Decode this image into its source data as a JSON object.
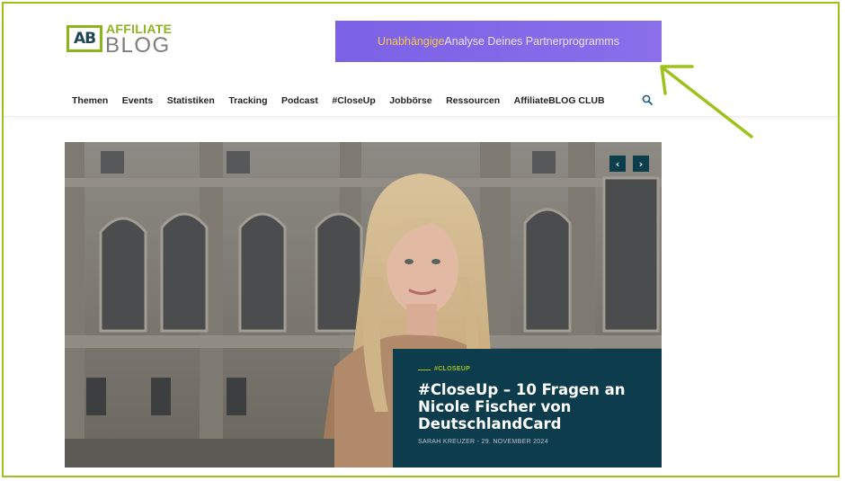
{
  "logo": {
    "mark": "AB",
    "top": "AFFILIATE",
    "bottom": "BLOG"
  },
  "banner": {
    "highlight": "Unabhängige",
    "text": " Analyse Deines Partnerprogramms"
  },
  "nav": {
    "items": [
      "Themen",
      "Events",
      "Statistiken",
      "Tracking",
      "Podcast",
      "#CloseUp",
      "Jobbörse",
      "Ressourcen",
      "AffiliateBLOG CLUB"
    ],
    "search_icon": "search-icon"
  },
  "slider": {
    "prev": "‹",
    "next": "›"
  },
  "featured": {
    "tag": "#CLOSEUP",
    "title": "#CloseUp – 10 Fragen an Nicole Fischer von DeutschlandCard",
    "meta": "SARAH KREUZER - 29. NOVEMBER 2024"
  },
  "colors": {
    "frame": "#9ec21c",
    "accent": "#8ab51d",
    "banner": "#7b61e6",
    "caption_bg": "#0d3c4c",
    "arrow": "#9ec21c"
  }
}
